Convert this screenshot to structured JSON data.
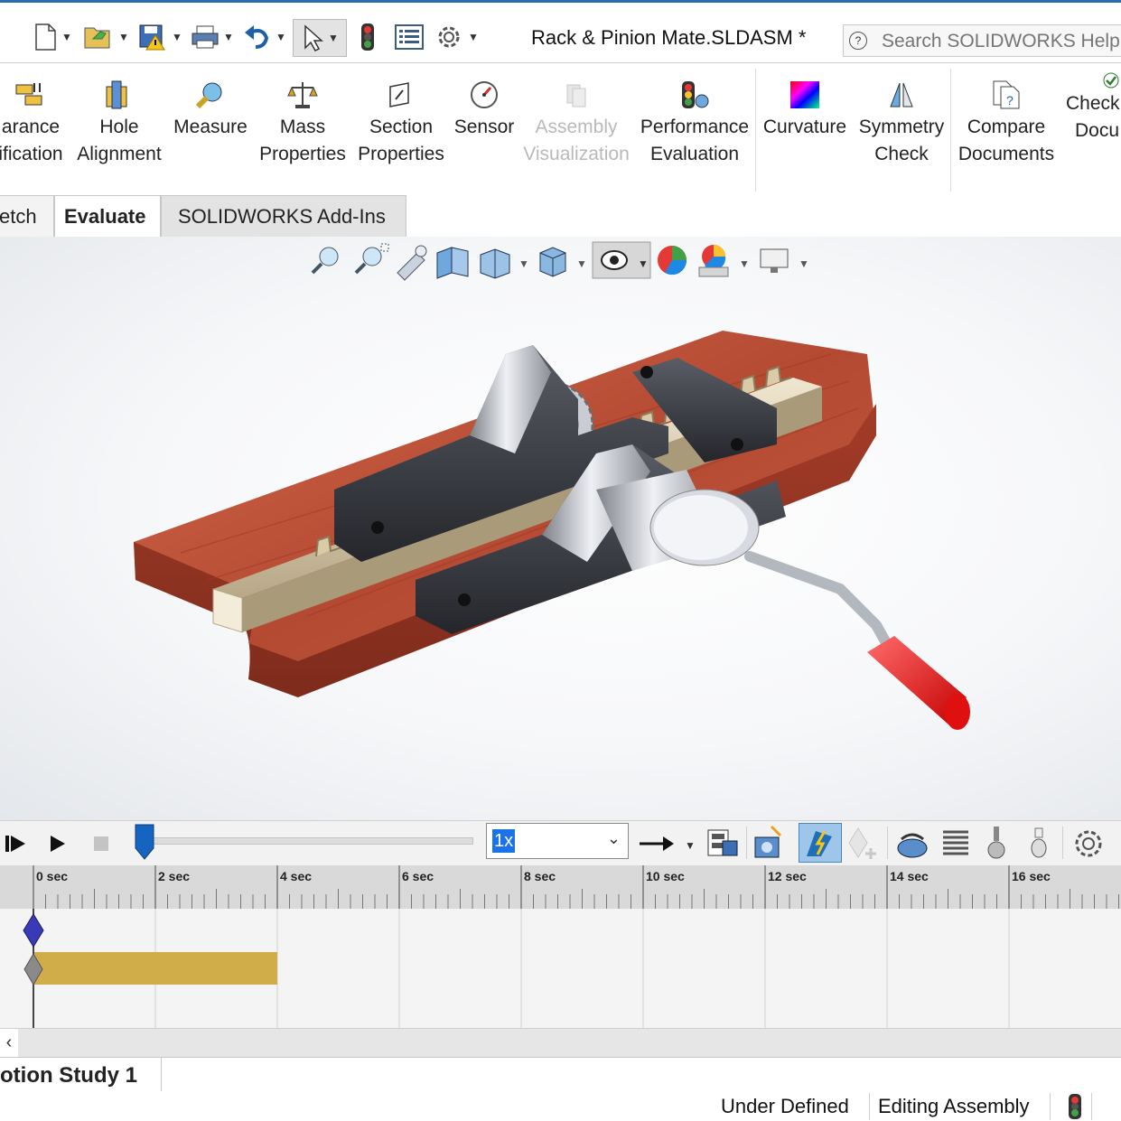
{
  "titlebar": {
    "doc_title": "Rack & Pinion Mate.SLDASM *",
    "search_placeholder": "Search SOLIDWORKS Help",
    "search_icon": "help-question-icon",
    "quick_access": [
      "new-document-icon",
      "open-file-icon",
      "save-icon",
      "print-icon",
      "undo-icon",
      "select-pointer-icon",
      "rebuild-traffic-light-icon",
      "file-properties-icon",
      "options-gear-icon"
    ]
  },
  "ribbon": {
    "items": [
      {
        "line1": "arance",
        "line2": "ification",
        "icon": "interference-icon"
      },
      {
        "line1": "Hole",
        "line2": "Alignment",
        "icon": "hole-alignment-icon"
      },
      {
        "line1": "Measure",
        "line2": "",
        "icon": "measure-icon"
      },
      {
        "line1": "Mass",
        "line2": "Properties",
        "icon": "mass-properties-icon"
      },
      {
        "line1": "Section",
        "line2": "Properties",
        "icon": "section-properties-icon"
      },
      {
        "line1": "Sensor",
        "line2": "",
        "icon": "sensor-icon"
      },
      {
        "line1": "Assembly",
        "line2": "Visualization",
        "icon": "assembly-visualization-icon"
      },
      {
        "line1": "Performance",
        "line2": "Evaluation",
        "icon": "performance-evaluation-icon"
      },
      {
        "line1": "Curvature",
        "line2": "",
        "icon": "curvature-icon"
      },
      {
        "line1": "Symmetry",
        "line2": "Check",
        "icon": "symmetry-check-icon"
      },
      {
        "line1": "Compare",
        "line2": "Documents",
        "icon": "compare-documents-icon"
      },
      {
        "line1": "Check",
        "line2": "Docu",
        "icon": "check-document-icon"
      }
    ]
  },
  "tabs": {
    "sketch": "etch",
    "evaluate": "Evaluate",
    "addins": "SOLIDWORKS Add-Ins"
  },
  "motion": {
    "speed": "1x",
    "time_labels": [
      "0 sec",
      "2 sec",
      "4 sec",
      "6 sec",
      "8 sec",
      "10 sec",
      "12 sec",
      "14 sec",
      "16 sec"
    ]
  },
  "study": {
    "tab_label": "otion Study 1",
    "scroll_left": "‹"
  },
  "status": {
    "definition": "Under Defined",
    "mode": "Editing Assembly"
  },
  "colors": {
    "accent": "#2b6cb0",
    "timeline_bar": "#d1ad4a",
    "key_blue": "#3a3ab8",
    "wood": "#b34a33",
    "handle_red": "#e02020"
  }
}
